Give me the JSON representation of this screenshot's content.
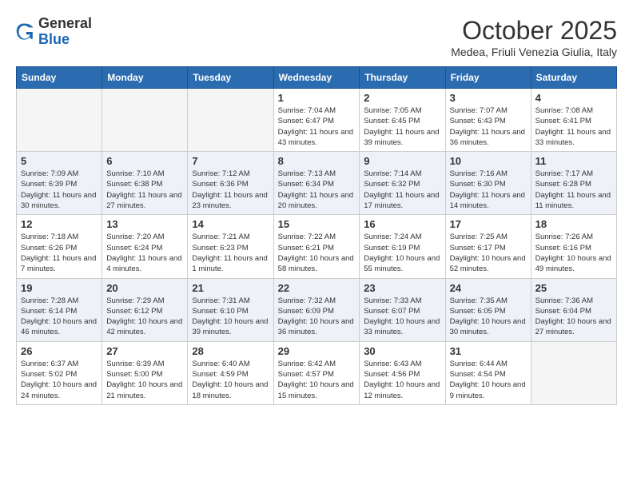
{
  "header": {
    "logo_general": "General",
    "logo_blue": "Blue",
    "month": "October 2025",
    "location": "Medea, Friuli Venezia Giulia, Italy"
  },
  "days_of_week": [
    "Sunday",
    "Monday",
    "Tuesday",
    "Wednesday",
    "Thursday",
    "Friday",
    "Saturday"
  ],
  "weeks": [
    [
      {
        "day": "",
        "info": ""
      },
      {
        "day": "",
        "info": ""
      },
      {
        "day": "",
        "info": ""
      },
      {
        "day": "1",
        "info": "Sunrise: 7:04 AM\nSunset: 6:47 PM\nDaylight: 11 hours and 43 minutes."
      },
      {
        "day": "2",
        "info": "Sunrise: 7:05 AM\nSunset: 6:45 PM\nDaylight: 11 hours and 39 minutes."
      },
      {
        "day": "3",
        "info": "Sunrise: 7:07 AM\nSunset: 6:43 PM\nDaylight: 11 hours and 36 minutes."
      },
      {
        "day": "4",
        "info": "Sunrise: 7:08 AM\nSunset: 6:41 PM\nDaylight: 11 hours and 33 minutes."
      }
    ],
    [
      {
        "day": "5",
        "info": "Sunrise: 7:09 AM\nSunset: 6:39 PM\nDaylight: 11 hours and 30 minutes."
      },
      {
        "day": "6",
        "info": "Sunrise: 7:10 AM\nSunset: 6:38 PM\nDaylight: 11 hours and 27 minutes."
      },
      {
        "day": "7",
        "info": "Sunrise: 7:12 AM\nSunset: 6:36 PM\nDaylight: 11 hours and 23 minutes."
      },
      {
        "day": "8",
        "info": "Sunrise: 7:13 AM\nSunset: 6:34 PM\nDaylight: 11 hours and 20 minutes."
      },
      {
        "day": "9",
        "info": "Sunrise: 7:14 AM\nSunset: 6:32 PM\nDaylight: 11 hours and 17 minutes."
      },
      {
        "day": "10",
        "info": "Sunrise: 7:16 AM\nSunset: 6:30 PM\nDaylight: 11 hours and 14 minutes."
      },
      {
        "day": "11",
        "info": "Sunrise: 7:17 AM\nSunset: 6:28 PM\nDaylight: 11 hours and 11 minutes."
      }
    ],
    [
      {
        "day": "12",
        "info": "Sunrise: 7:18 AM\nSunset: 6:26 PM\nDaylight: 11 hours and 7 minutes."
      },
      {
        "day": "13",
        "info": "Sunrise: 7:20 AM\nSunset: 6:24 PM\nDaylight: 11 hours and 4 minutes."
      },
      {
        "day": "14",
        "info": "Sunrise: 7:21 AM\nSunset: 6:23 PM\nDaylight: 11 hours and 1 minute."
      },
      {
        "day": "15",
        "info": "Sunrise: 7:22 AM\nSunset: 6:21 PM\nDaylight: 10 hours and 58 minutes."
      },
      {
        "day": "16",
        "info": "Sunrise: 7:24 AM\nSunset: 6:19 PM\nDaylight: 10 hours and 55 minutes."
      },
      {
        "day": "17",
        "info": "Sunrise: 7:25 AM\nSunset: 6:17 PM\nDaylight: 10 hours and 52 minutes."
      },
      {
        "day": "18",
        "info": "Sunrise: 7:26 AM\nSunset: 6:16 PM\nDaylight: 10 hours and 49 minutes."
      }
    ],
    [
      {
        "day": "19",
        "info": "Sunrise: 7:28 AM\nSunset: 6:14 PM\nDaylight: 10 hours and 46 minutes."
      },
      {
        "day": "20",
        "info": "Sunrise: 7:29 AM\nSunset: 6:12 PM\nDaylight: 10 hours and 42 minutes."
      },
      {
        "day": "21",
        "info": "Sunrise: 7:31 AM\nSunset: 6:10 PM\nDaylight: 10 hours and 39 minutes."
      },
      {
        "day": "22",
        "info": "Sunrise: 7:32 AM\nSunset: 6:09 PM\nDaylight: 10 hours and 36 minutes."
      },
      {
        "day": "23",
        "info": "Sunrise: 7:33 AM\nSunset: 6:07 PM\nDaylight: 10 hours and 33 minutes."
      },
      {
        "day": "24",
        "info": "Sunrise: 7:35 AM\nSunset: 6:05 PM\nDaylight: 10 hours and 30 minutes."
      },
      {
        "day": "25",
        "info": "Sunrise: 7:36 AM\nSunset: 6:04 PM\nDaylight: 10 hours and 27 minutes."
      }
    ],
    [
      {
        "day": "26",
        "info": "Sunrise: 6:37 AM\nSunset: 5:02 PM\nDaylight: 10 hours and 24 minutes."
      },
      {
        "day": "27",
        "info": "Sunrise: 6:39 AM\nSunset: 5:00 PM\nDaylight: 10 hours and 21 minutes."
      },
      {
        "day": "28",
        "info": "Sunrise: 6:40 AM\nSunset: 4:59 PM\nDaylight: 10 hours and 18 minutes."
      },
      {
        "day": "29",
        "info": "Sunrise: 6:42 AM\nSunset: 4:57 PM\nDaylight: 10 hours and 15 minutes."
      },
      {
        "day": "30",
        "info": "Sunrise: 6:43 AM\nSunset: 4:56 PM\nDaylight: 10 hours and 12 minutes."
      },
      {
        "day": "31",
        "info": "Sunrise: 6:44 AM\nSunset: 4:54 PM\nDaylight: 10 hours and 9 minutes."
      },
      {
        "day": "",
        "info": ""
      }
    ]
  ]
}
